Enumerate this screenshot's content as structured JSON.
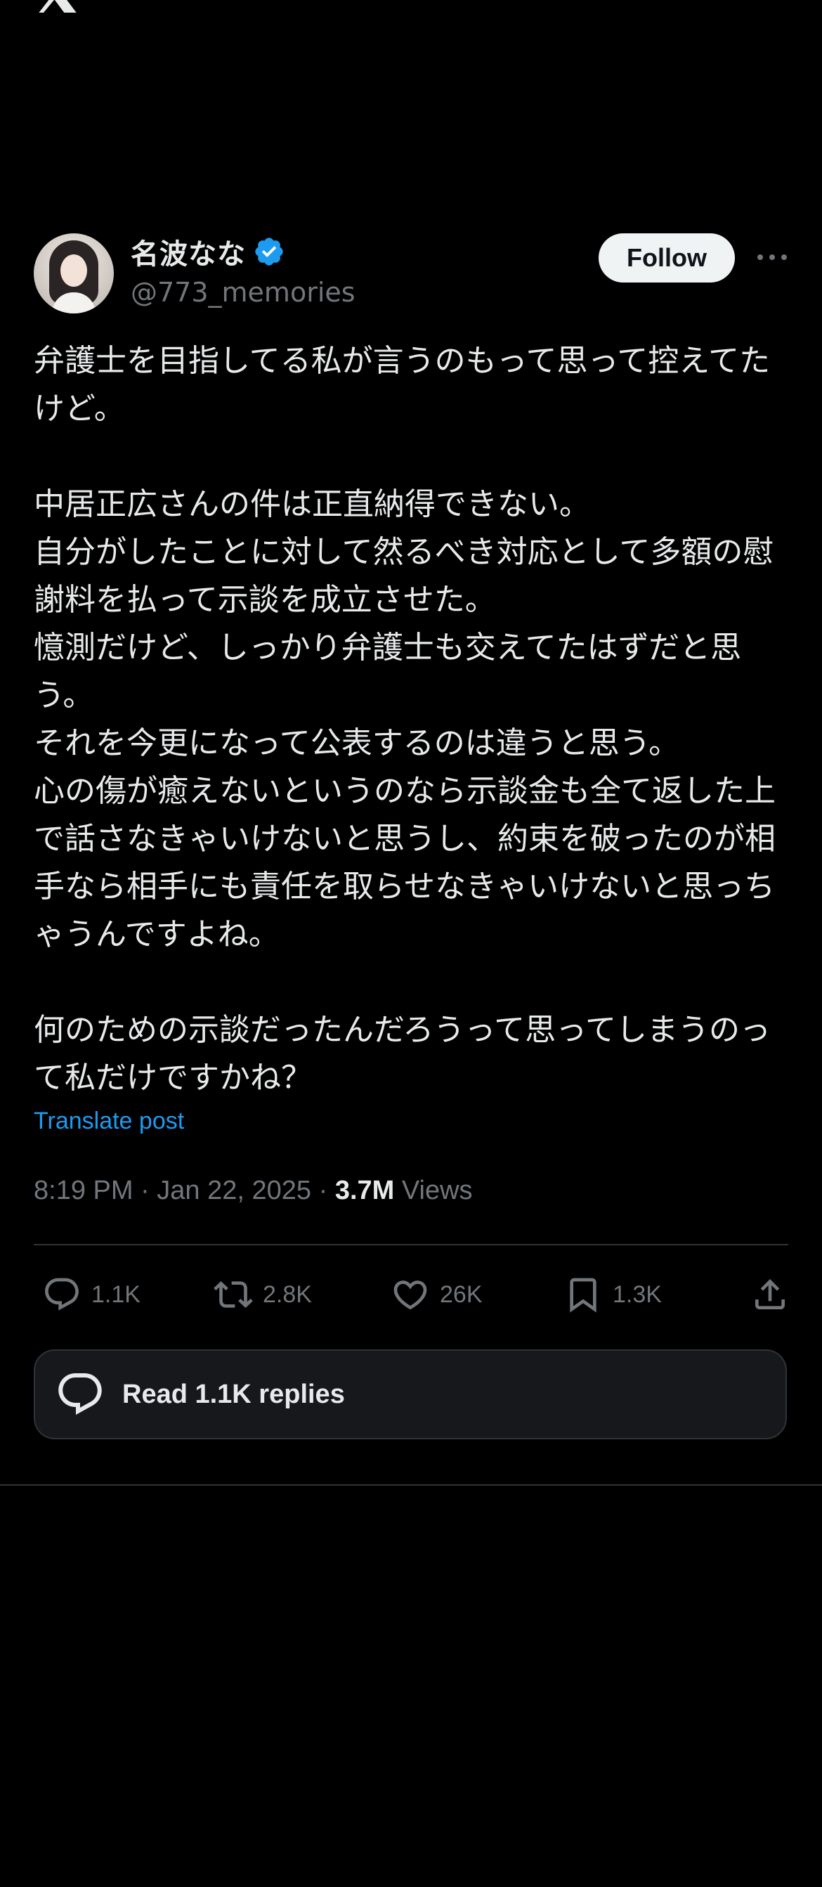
{
  "colors": {
    "background": "#000000",
    "text_primary": "#e7e9ea",
    "text_secondary": "#71767b",
    "link": "#1d9bf0",
    "verified": "#1d9bf0",
    "divider": "#2f3336",
    "follow_bg": "#eff3f4"
  },
  "app": {
    "logo_icon": "x-logo-icon"
  },
  "author": {
    "display_name": "名波なな",
    "handle": "@773_memories",
    "verified": true,
    "follow_label": "Follow"
  },
  "tweet": {
    "text": "弁護士を目指してる私が言うのもって思って控えてたけど。\n\n中居正広さんの件は正直納得できない。\n自分がしたことに対して然るべき対応として多額の慰謝料を払って示談を成立させた。\n憶測だけど、しっかり弁護士も交えてたはずだと思う。\nそれを今更になって公表するのは違うと思う。\n心の傷が癒えないというのなら示談金も全て返した上で話さなきゃいけないと思うし、約束を破ったのが相手なら相手にも責任を取らせなきゃいけないと思っちゃうんですよね。\n\n何のための示談だったんだろうって思ってしまうのって私だけですかね？",
    "translate_label": "Translate post",
    "timestamp": "8:19 PM · Jan 22, 2025 · ",
    "views_count": "3.7M",
    "views_label": " Views"
  },
  "actions": {
    "replies": "1.1K",
    "reposts": "2.8K",
    "likes": "26K",
    "bookmarks": "1.3K"
  },
  "read_replies_label": "Read 1.1K replies"
}
